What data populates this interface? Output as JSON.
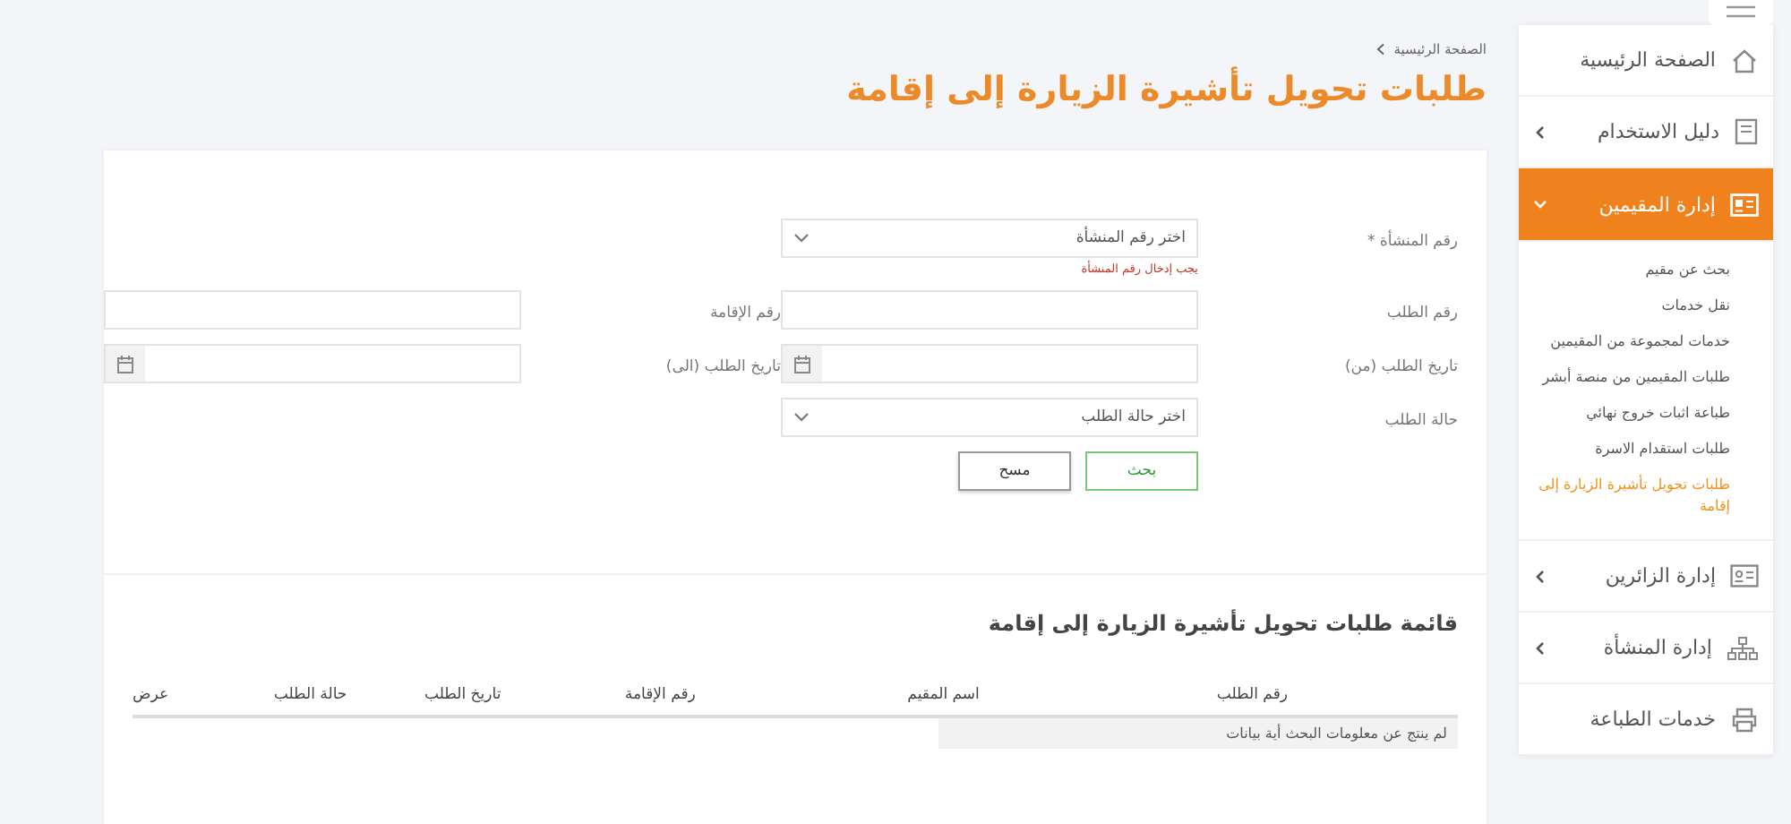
{
  "breadcrumb": [
    {
      "label": "الصفحة الرئيسية"
    }
  ],
  "page_title": "طلبات تحويل تأشيرة الزيارة إلى إقامة",
  "form": {
    "rows": [
      [
        {
          "kind": "select",
          "label": "رقم المنشأة *",
          "placeholder": "اختر رقم المنشأة",
          "error": "يجب إدخال رقم المنشأة"
        }
      ],
      [
        {
          "kind": "text",
          "label": "رقم الطلب"
        },
        {
          "kind": "text",
          "label": "رقم الإقامة"
        }
      ],
      [
        {
          "kind": "date",
          "label": "تاريخ الطلب (من)"
        },
        {
          "kind": "date",
          "label": "تاريخ الطلب (الى)"
        }
      ],
      [
        {
          "kind": "select",
          "label": "حالة الطلب",
          "placeholder": "اختر حالة الطلب"
        }
      ]
    ],
    "buttons": [
      {
        "label": "بحث",
        "kind": "primary"
      },
      {
        "label": "مسح",
        "kind": "secondary"
      }
    ]
  },
  "table": {
    "title": "قائمة طلبات تحويل تأشيرة الزيارة إلى إقامة",
    "columns": [
      "رقم الطلب",
      "اسم المقيم",
      "رقم الإقامة",
      "تاريخ الطلب",
      "حالة الطلب",
      "عرض"
    ],
    "empty_message": "لم ينتج عن معلومات البحث أية بيانات"
  },
  "sidebar": {
    "items": [
      {
        "label": "الصفحة الرئيسية",
        "kind": "link",
        "expanded": false
      },
      {
        "label": "دليل الاستخدام",
        "kind": "group",
        "expanded": false
      },
      {
        "label": "إدارة المقيمين",
        "kind": "group",
        "expanded": true,
        "children": [
          {
            "label": "بحث عن مقيم",
            "selected": false
          },
          {
            "label": "نقل خدمات",
            "selected": false
          },
          {
            "label": "خدمات لمجموعة من المقيمين",
            "selected": false
          },
          {
            "label": "طلبات المقيمين من منصة أبشر",
            "selected": false
          },
          {
            "label": "طباعة اثبات خروج نهائي",
            "selected": false
          },
          {
            "label": "طلبات استقدام الاسرة",
            "selected": false
          },
          {
            "label": "طلبات تحويل تأشيرة الزيارة إلى إقامة",
            "selected": true
          }
        ]
      },
      {
        "label": "إدارة الزائرين",
        "kind": "group",
        "expanded": false
      },
      {
        "label": "إدارة المنشأة",
        "kind": "group",
        "expanded": false
      },
      {
        "label": "خدمات الطباعة",
        "kind": "link",
        "expanded": false
      }
    ]
  }
}
